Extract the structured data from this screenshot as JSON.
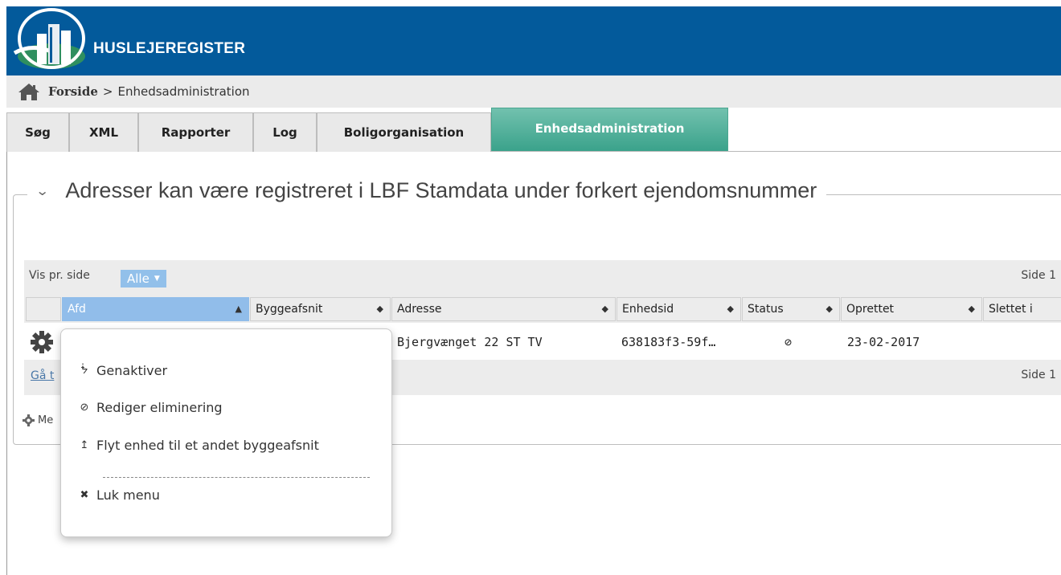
{
  "header": {
    "brand": "HUSLEJEREGISTER"
  },
  "breadcrumb": {
    "home": "Forside",
    "separator": ">",
    "current": "Enhedsadministration"
  },
  "tabs": [
    {
      "label": "Søg"
    },
    {
      "label": "XML"
    },
    {
      "label": "Rapporter"
    },
    {
      "label": "Log"
    },
    {
      "label": "Boligorganisation"
    },
    {
      "label": "Enhedsadministration",
      "active": true
    }
  ],
  "panel": {
    "title": "Adresser kan være registreret i LBF Stamdata under forkert ejendomsnummer",
    "chevron": "⌄"
  },
  "pager": {
    "vis_label": "Vis pr. side",
    "per_page": "Alle",
    "side_label": "Side 1"
  },
  "table": {
    "columns": [
      {
        "label": ""
      },
      {
        "label": "Afd",
        "sort": "▲"
      },
      {
        "label": "Byggeafsnit",
        "sort": "◆"
      },
      {
        "label": "Adresse",
        "sort": "◆"
      },
      {
        "label": "Enhedsid",
        "sort": "◆"
      },
      {
        "label": "Status",
        "sort": "◆"
      },
      {
        "label": "Oprettet",
        "sort": "◆"
      },
      {
        "label": "Slettet i",
        "sort": ""
      }
    ],
    "rows": [
      {
        "adresse": "Bjergvænget 22 ST TV",
        "enhedsid": "638183f3-59f…",
        "status": "⊘",
        "oprettet": "23-02-2017"
      }
    ]
  },
  "footer": {
    "goto": "Gå t",
    "side_label": "Side 1",
    "menu_label": "Me"
  },
  "context_menu": {
    "items": [
      {
        "icon": "rss-icon",
        "glyph": "ᖭ",
        "label": "Genaktiver"
      },
      {
        "icon": "ban-icon",
        "glyph": "⊘",
        "label": "Rediger eliminering"
      },
      {
        "icon": "move-up-icon",
        "glyph": "↥",
        "label": "Flyt enhed til et andet byggeafsnit"
      }
    ],
    "close": {
      "icon": "close-icon",
      "glyph": "✖",
      "label": "Luk menu"
    }
  },
  "colors": {
    "header": "#035a9b",
    "active_tab": "#3aa28b",
    "selected_column": "#91bdea"
  }
}
